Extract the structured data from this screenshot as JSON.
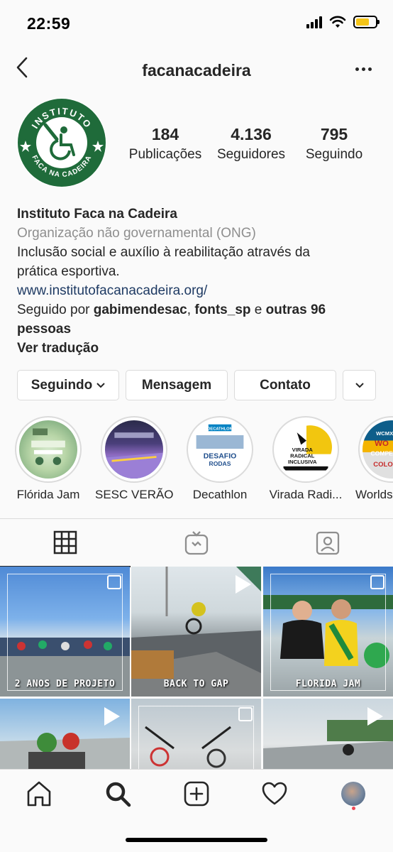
{
  "status_bar": {
    "time": "22:59",
    "battery_level": 0.7
  },
  "header": {
    "title": "facanacadeira"
  },
  "profile": {
    "avatar_logo_text_top": "INSTITUTO",
    "avatar_logo_text_bottom": "FACA NA CADEIRA",
    "stats": [
      {
        "value": "184",
        "label": "Publicações"
      },
      {
        "value": "4.136",
        "label": "Seguidores"
      },
      {
        "value": "795",
        "label": "Seguindo"
      }
    ]
  },
  "bio": {
    "name": "Instituto Faca na Cadeira",
    "category": "Organização não governamental (ONG)",
    "description_line1": "Inclusão social e auxílio à reabilitação através da",
    "description_line2": "prática esportiva.",
    "link": "www.institutofacanacadeira.org/",
    "followed_by_prefix": "Seguido por ",
    "followed_user1": "gabimendesac",
    "followed_sep": ", ",
    "followed_user2": "fonts_sp",
    "followed_and": " e ",
    "followed_others": "outras 96",
    "followed_others2": "pessoas",
    "translate": "Ver tradução"
  },
  "buttons": {
    "following": "Seguindo",
    "message": "Mensagem",
    "contact": "Contato"
  },
  "highlights": [
    {
      "label": "Flórida Jam"
    },
    {
      "label": "SESC VERÃO"
    },
    {
      "label": "Decathlon"
    },
    {
      "label": "Virada Radi..."
    },
    {
      "label": "Worlds"
    }
  ],
  "highlight_texts": {
    "decathlon_brand": "DECATHLON",
    "decathlon_title1": "DESAFIO",
    "decathlon_title2": "RODAS",
    "virada_line1": "VIRADA",
    "virada_line2": "RADICAL",
    "virada_line3": "INCLUSIVA",
    "worlds_line1": "WCMX",
    "worlds_line2": "WO",
    "worlds_line3": "COMPETITI",
    "worlds_line4": "COLOG"
  },
  "posts": [
    {
      "caption": "2 ANOS DE PROJETO",
      "type": "multi"
    },
    {
      "caption": "BACK TO GAP",
      "type": "video"
    },
    {
      "caption": "FLORIDA JAM",
      "type": "multi"
    },
    {
      "caption": "",
      "type": "video"
    },
    {
      "caption": "",
      "type": "multi"
    },
    {
      "caption": "",
      "type": "video"
    }
  ],
  "colors": {
    "text": "#262626",
    "secondary": "#8e8e8e",
    "link": "#1e3a63",
    "border": "#dbdbdb",
    "logo_green": "#1f6b3a",
    "notification": "#ed4956"
  }
}
